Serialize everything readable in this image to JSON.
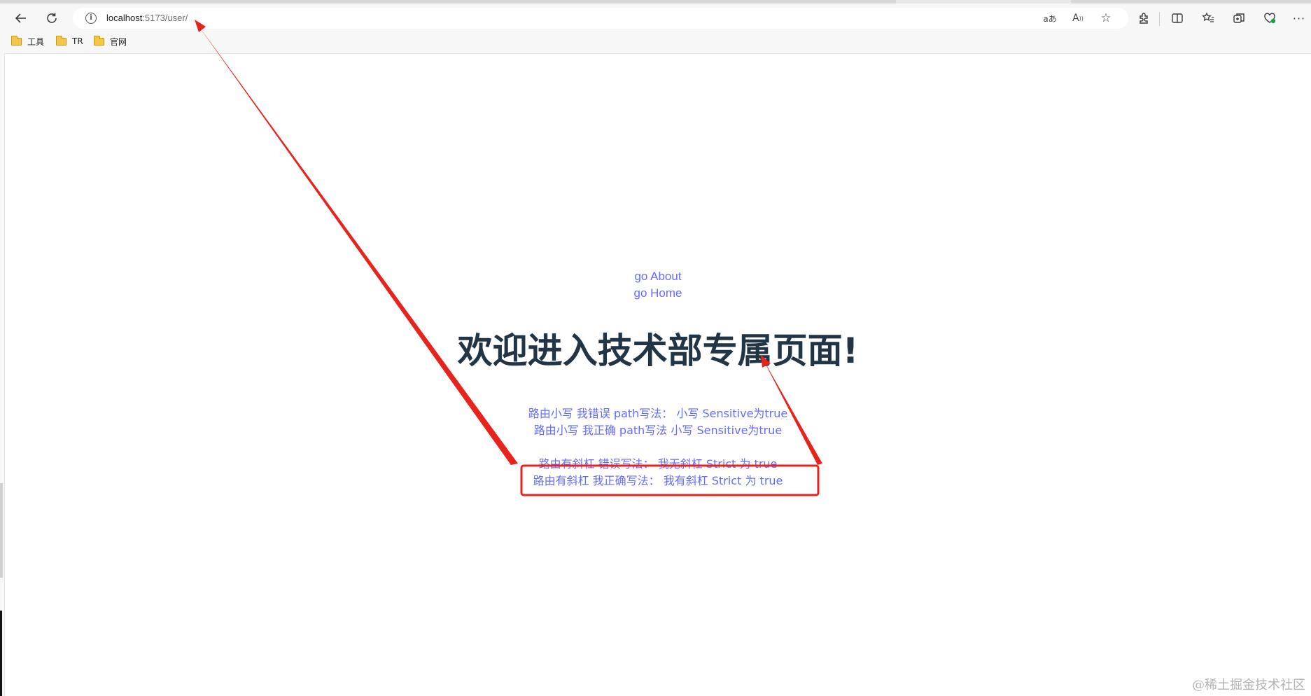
{
  "browser": {
    "url_host": "localhost",
    "url_path": ":5173/user/",
    "translate_glyph": "aあ",
    "read_aloud_glyph": "A",
    "bookmarks": [
      {
        "label": "工具"
      },
      {
        "label": "TR"
      },
      {
        "label": "官网"
      }
    ]
  },
  "page": {
    "nav_links": [
      "go About",
      "go Home"
    ],
    "heading": "欢迎进入技术部专属页面!",
    "route_links": [
      "路由小写 我错误 path写法： 小写 Sensitive为true",
      "路由小写 我正确 path写法 小写 Sensitive为true",
      "路由有斜杠 错误写法： 我无斜杠 Strict 为 true",
      "路由有斜杠 我正确写法： 我有斜杠 Strict 为 true"
    ],
    "watermark": "@稀土掘金技术社区"
  },
  "colors": {
    "link": "#646cff",
    "heading": "#213547",
    "annotation": "#e8231c"
  }
}
